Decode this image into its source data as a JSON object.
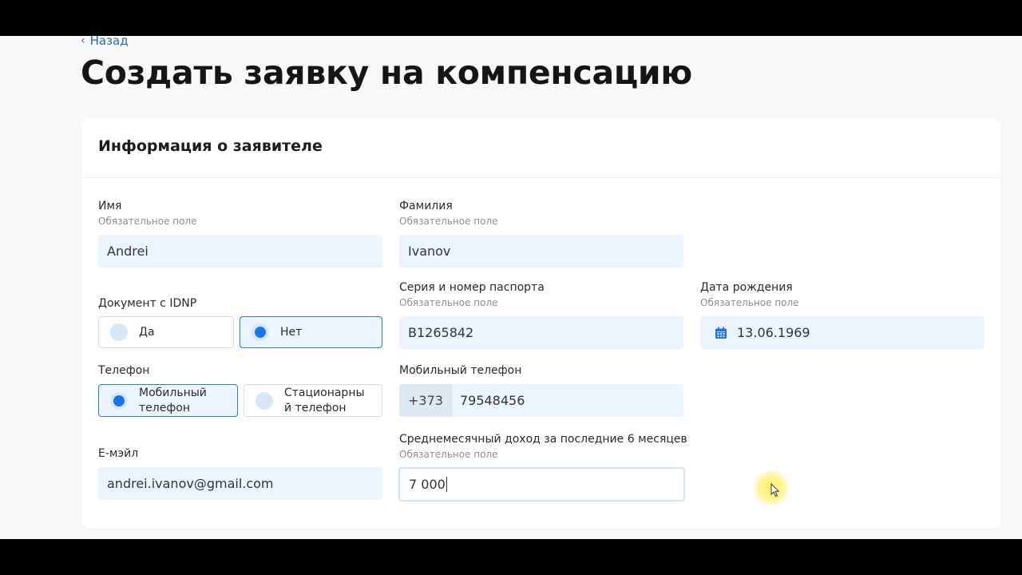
{
  "nav": {
    "back_label": "Назад"
  },
  "page": {
    "title": "Создать заявку на компенсацию"
  },
  "card": {
    "title": "Информация о заявителе"
  },
  "required_hint": "Обязательное поле",
  "fields": {
    "first_name": {
      "label": "Имя",
      "value": "Andrei"
    },
    "last_name": {
      "label": "Фамилия",
      "value": "Ivanov"
    },
    "idnp_doc": {
      "label": "Документ с IDNP",
      "options": [
        "Да",
        "Нет"
      ],
      "selected": "Нет"
    },
    "passport": {
      "label": "Серия и номер паспорта",
      "value": "B1265842"
    },
    "birth_date": {
      "label": "Дата рождения",
      "value": "13.06.1969",
      "icon": "calendar-icon"
    },
    "phone_type": {
      "label": "Телефон",
      "options": [
        "Мобильный телефон",
        "Стационарный телефон"
      ],
      "option_lines": [
        [
          "Мобильный",
          "телефон"
        ],
        [
          "Стационарны",
          "й телефон"
        ]
      ],
      "selected": "Мобильный телефон"
    },
    "mobile_phone": {
      "label": "Мобильный телефон",
      "prefix": "+373",
      "value": "79548456"
    },
    "email": {
      "label": "E-мэйл",
      "value": "andrei.ivanov@gmail.com"
    },
    "income": {
      "label": "Среднемесячный доход за последние 6 месяцев",
      "value": "7 000"
    }
  },
  "colors": {
    "accent": "#1a73e8",
    "input_bg": "#ecf5fd",
    "link": "#2b6cb0"
  }
}
